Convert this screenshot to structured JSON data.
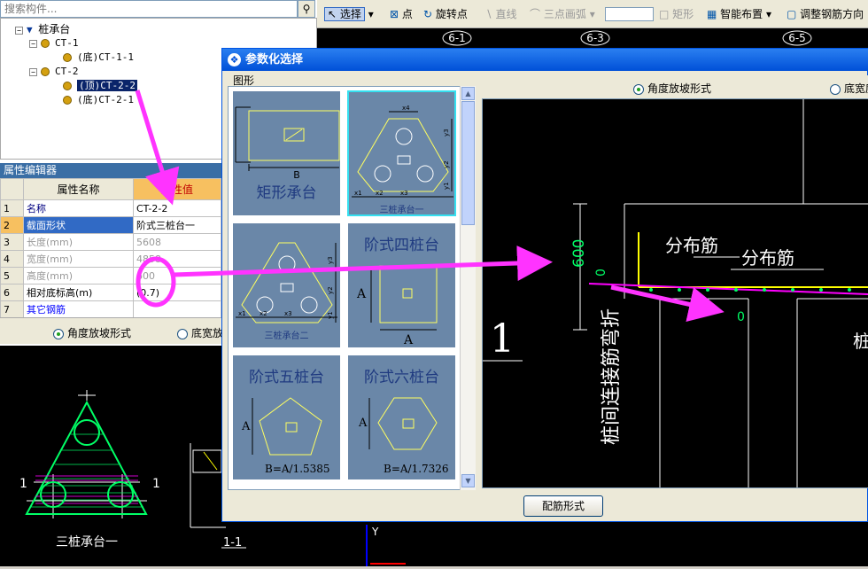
{
  "search": {
    "placeholder": "搜索构件..."
  },
  "tree": {
    "root": "桩承台",
    "nodes": [
      {
        "label": "CT-1",
        "level": 1
      },
      {
        "label": "(底)CT-1-1",
        "level": 2
      },
      {
        "label": "CT-2",
        "level": 1
      },
      {
        "label": "(顶)CT-2-2",
        "level": 2,
        "selected": true
      },
      {
        "label": "(底)CT-2-1",
        "level": 2
      }
    ]
  },
  "props": {
    "title": "属性编辑器",
    "col_name": "属性名称",
    "col_value": "属性值",
    "rows": [
      {
        "n": "1",
        "name": "名称",
        "value": "CT-2-2"
      },
      {
        "n": "2",
        "name": "截面形状",
        "value": "阶式三桩台一"
      },
      {
        "n": "3",
        "name": "长度(mm)",
        "value": "5608"
      },
      {
        "n": "4",
        "name": "宽度(mm)",
        "value": "4858"
      },
      {
        "n": "5",
        "name": "高度(mm)",
        "value": "600"
      },
      {
        "n": "6",
        "name": "相对底标高(m)",
        "value": "(0.7)"
      },
      {
        "n": "7",
        "name": "其它钢筋",
        "value": ""
      }
    ]
  },
  "left_options": {
    "opt1": "角度放坡形式",
    "opt2": "底宽放"
  },
  "left_cad": {
    "caption": "三桩承台一",
    "section": "1-1",
    "mark1": "1"
  },
  "toolbar": {
    "select": "选择",
    "point": "点",
    "rotate_point": "旋转点",
    "line": "直线",
    "arc": "三点画弧",
    "rect": "矩形",
    "smart_layout": "智能布置",
    "adjust": "调整钢筋方向"
  },
  "axes": {
    "a": "6-1",
    "b": "6-3",
    "c": "6-5"
  },
  "dialog": {
    "title": "参数化选择",
    "shapes_label": "图形",
    "option_angle": "角度放坡形式",
    "option_width": "底宽度",
    "rebar_button": "配筋形式",
    "cards": [
      {
        "title": "矩形承台",
        "label_b": "B"
      },
      {
        "title": "三桩承台一",
        "x4": "x4",
        "x1": "x1",
        "x2": "x2",
        "x3": "x3",
        "y1": "y1",
        "y2": "y2",
        "y3": "y3"
      },
      {
        "title": "三桩承台二",
        "x1": "x1",
        "x2": "x2",
        "x3": "x3",
        "y1": "y1",
        "y2": "y2",
        "y3": "y3"
      },
      {
        "title": "阶式四桩台",
        "a1": "A",
        "a2": "A"
      },
      {
        "title": "阶式五桩台",
        "a": "A",
        "formula": "B=A/1.5385"
      },
      {
        "title": "阶式六桩台",
        "a": "A",
        "formula": "B=A/1.7326"
      }
    ],
    "preview": {
      "rebar1": "分布筋",
      "rebar2": "分布筋",
      "height": "600",
      "zero1": "0",
      "zero2": "0",
      "vertical_text": "桩间连接筋弯折",
      "section_mark": "1",
      "side_text": "桩"
    }
  },
  "colors": {
    "accent": "#0054e3",
    "arrow": "#ff33ff",
    "cad_bg": "#000000",
    "rebar": "#ffff00"
  }
}
